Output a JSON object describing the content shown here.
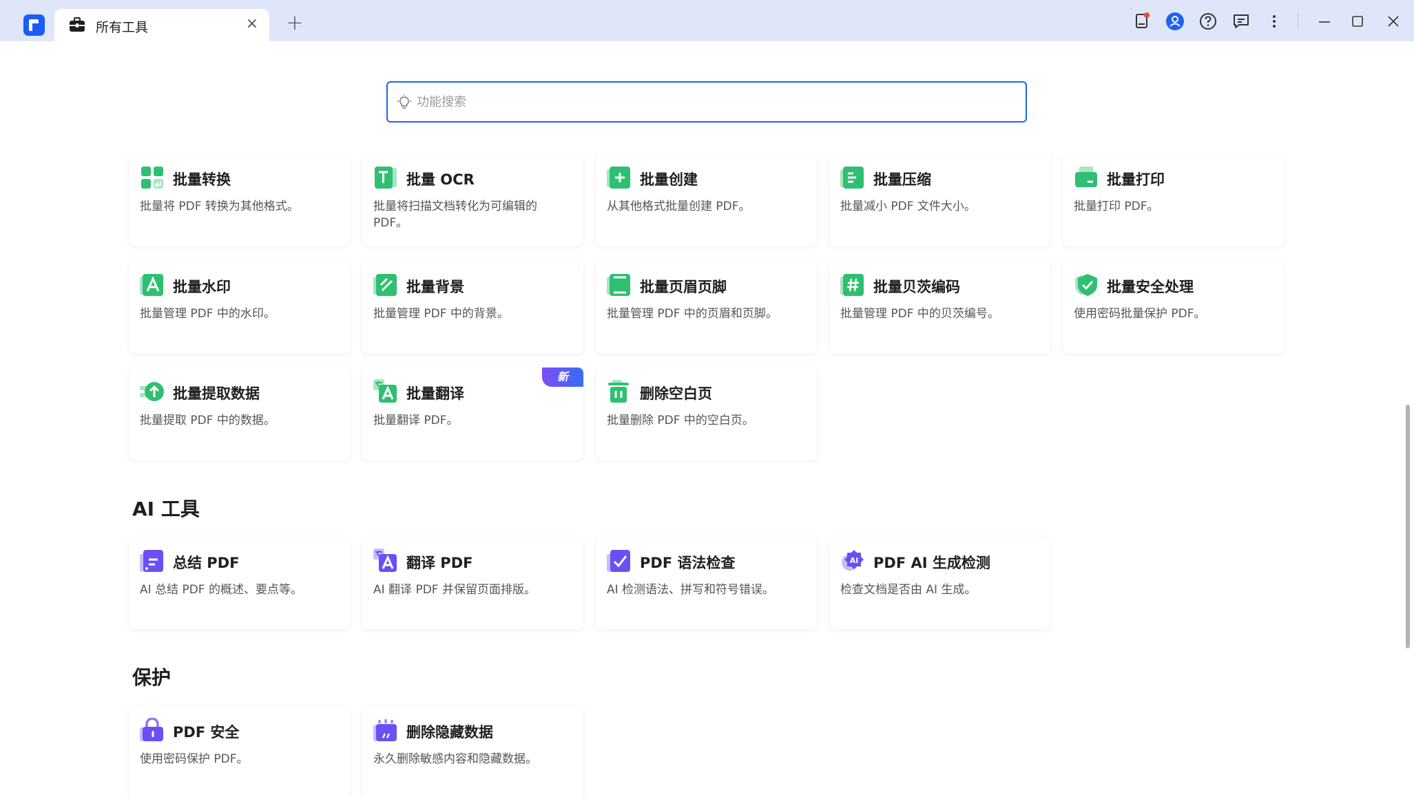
{
  "tab": {
    "title": "所有工具",
    "close": "×"
  },
  "tab_add": "+",
  "search": {
    "placeholder": "功能搜索",
    "value": ""
  },
  "batch": [
    {
      "title": "批量转换",
      "desc": "批量将 PDF 转换为其他格式。",
      "icon": "batch-convert-icon"
    },
    {
      "title": "批量 OCR",
      "desc": "批量将扫描文档转化为可编辑的 PDF。",
      "icon": "batch-ocr-icon"
    },
    {
      "title": "批量创建",
      "desc": "从其他格式批量创建 PDF。",
      "icon": "batch-create-icon"
    },
    {
      "title": "批量压缩",
      "desc": "批量减小 PDF 文件大小。",
      "icon": "batch-compress-icon"
    },
    {
      "title": "批量打印",
      "desc": "批量打印 PDF。",
      "icon": "batch-print-icon"
    },
    {
      "title": "批量水印",
      "desc": "批量管理 PDF 中的水印。",
      "icon": "batch-watermark-icon"
    },
    {
      "title": "批量背景",
      "desc": "批量管理 PDF 中的背景。",
      "icon": "batch-background-icon"
    },
    {
      "title": "批量页眉页脚",
      "desc": "批量管理 PDF 中的页眉和页脚。",
      "icon": "batch-header-footer-icon"
    },
    {
      "title": "批量贝茨编码",
      "desc": "批量管理 PDF 中的贝茨编号。",
      "icon": "batch-bates-icon"
    },
    {
      "title": "批量安全处理",
      "desc": "使用密码批量保护 PDF。",
      "icon": "batch-security-icon"
    },
    {
      "title": "批量提取数据",
      "desc": "批量提取 PDF 中的数据。",
      "icon": "batch-extract-icon"
    },
    {
      "title": "批量翻译",
      "desc": "批量翻译 PDF。",
      "icon": "batch-translate-icon",
      "badge": "新"
    },
    {
      "title": "删除空白页",
      "desc": "批量删除 PDF 中的空白页。",
      "icon": "delete-blank-icon"
    }
  ],
  "ai_section": {
    "title": "AI 工具"
  },
  "ai": [
    {
      "title": "总结 PDF",
      "desc": "AI 总结 PDF 的概述、要点等。",
      "icon": "summarize-icon"
    },
    {
      "title": "翻译 PDF",
      "desc": "AI 翻译 PDF 并保留页面排版。",
      "icon": "translate-icon"
    },
    {
      "title": "PDF 语法检查",
      "desc": "AI 检测语法、拼写和符号错误。",
      "icon": "grammar-icon"
    },
    {
      "title": "PDF AI 生成检测",
      "desc": "检查文档是否由 AI 生成。",
      "icon": "ai-detect-icon"
    }
  ],
  "protect_section": {
    "title": "保护"
  },
  "protect": [
    {
      "title": "PDF 安全",
      "desc": "使用密码保护 PDF。",
      "icon": "lock-icon"
    },
    {
      "title": "删除隐藏数据",
      "desc": "永久删除敏感内容和隐藏数据。",
      "icon": "remove-hidden-data-icon"
    }
  ],
  "colors": {
    "accent": "#1e62f0",
    "green": "#2fbf71",
    "purple": "#6b4ff5",
    "titlebar": "#dfe6f9"
  }
}
